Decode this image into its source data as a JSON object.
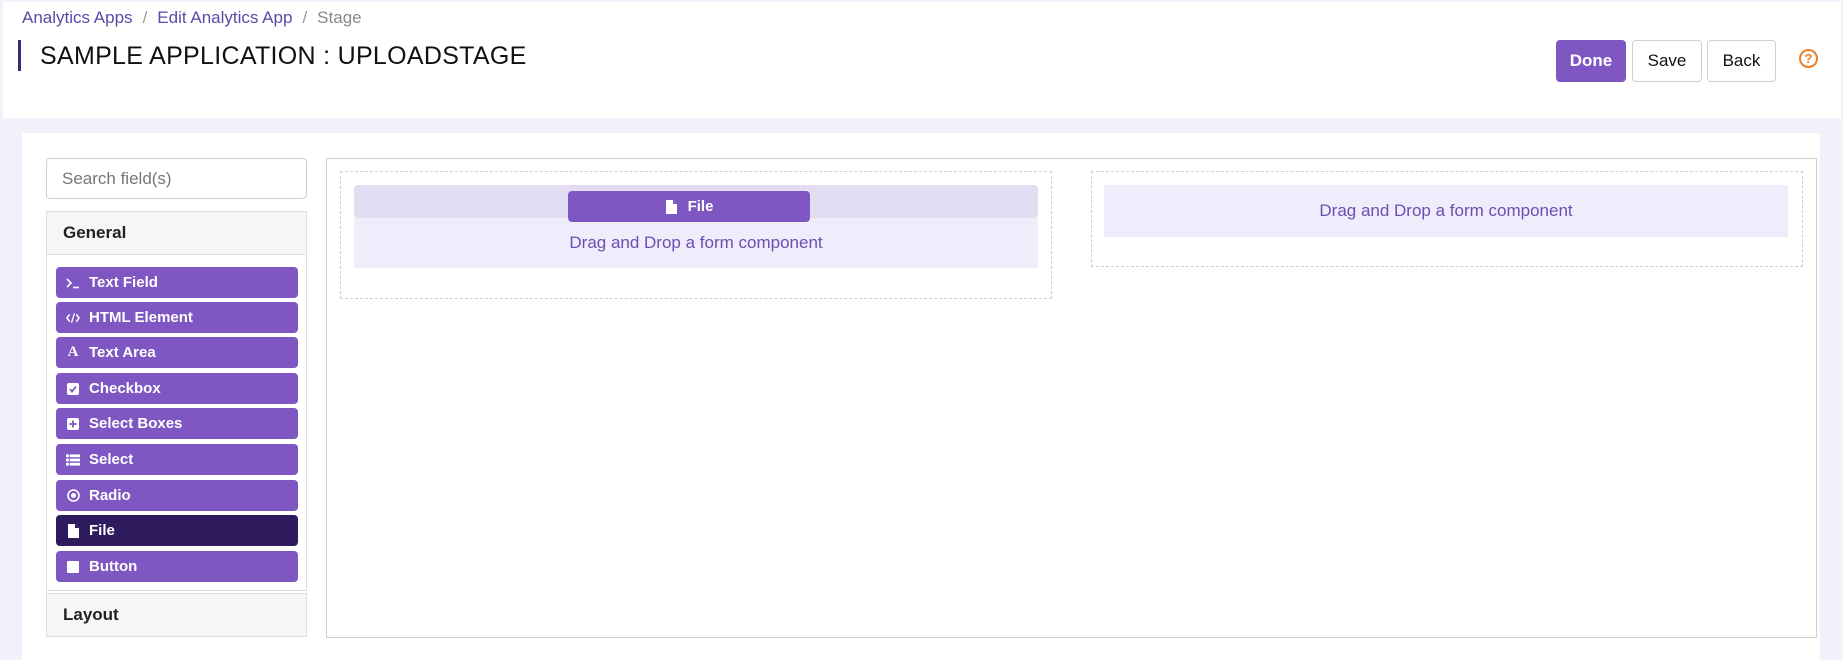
{
  "breadcrumb": {
    "items": [
      "Analytics Apps",
      "Edit Analytics App"
    ],
    "current": "Stage",
    "separator": "/"
  },
  "page": {
    "title": "SAMPLE APPLICATION : UPLOADSTAGE"
  },
  "actions": {
    "done": "Done",
    "save": "Save",
    "back": "Back",
    "help": "?"
  },
  "sidebar": {
    "search_placeholder": "Search field(s)",
    "groups": [
      {
        "label": "General",
        "items": [
          {
            "label": "Text Field",
            "icon": "terminal-icon"
          },
          {
            "label": "HTML Element",
            "icon": "code-icon"
          },
          {
            "label": "Text Area",
            "icon": "font-icon"
          },
          {
            "label": "Checkbox",
            "icon": "check-square-icon"
          },
          {
            "label": "Select Boxes",
            "icon": "plus-square-icon"
          },
          {
            "label": "Select",
            "icon": "list-icon"
          },
          {
            "label": "Radio",
            "icon": "dot-circle-icon"
          },
          {
            "label": "File",
            "icon": "file-icon",
            "active": true
          },
          {
            "label": "Button",
            "icon": "stop-icon"
          }
        ]
      },
      {
        "label": "Layout",
        "items": []
      }
    ]
  },
  "canvas": {
    "drop_text": "Drag and Drop a form component",
    "dragging": {
      "label": "File",
      "icon": "file-icon"
    }
  },
  "colors": {
    "accent": "#7e57c2",
    "active": "#2d1b5e",
    "dropzone_bg": "#efedfc",
    "help": "#ef7d22"
  }
}
